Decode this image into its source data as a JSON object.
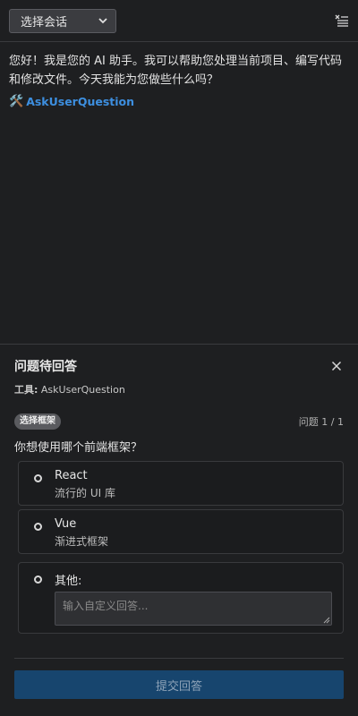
{
  "header": {
    "session_select": {
      "selected": "选择会话"
    },
    "menu_icon": "menu-icon"
  },
  "chat": {
    "assistant_message": "您好！我是您的 AI 助手。我可以帮助您处理当前项目、编写代码和修改文件。今天我能为您做些什么吗？",
    "tool_icon": "🛠️",
    "tool_name": "AskUserQuestion"
  },
  "question_panel": {
    "title": "问题待回答",
    "tool_label": "工具:",
    "tool_value": "AskUserQuestion",
    "badge": "选择框架",
    "counter": "问题 1 / 1",
    "question": "你想使用哪个前端框架？",
    "options": [
      {
        "label": "React",
        "description": "流行的 UI 库"
      },
      {
        "label": "Vue",
        "description": "渐进式框架"
      }
    ],
    "other_label": "其他:",
    "other_placeholder": "输入自定义回答...",
    "submit_label": "提交回答"
  },
  "colors": {
    "background": "#1e1f21",
    "accent_link": "#3d8fe0",
    "submit_bg": "#17456e"
  }
}
